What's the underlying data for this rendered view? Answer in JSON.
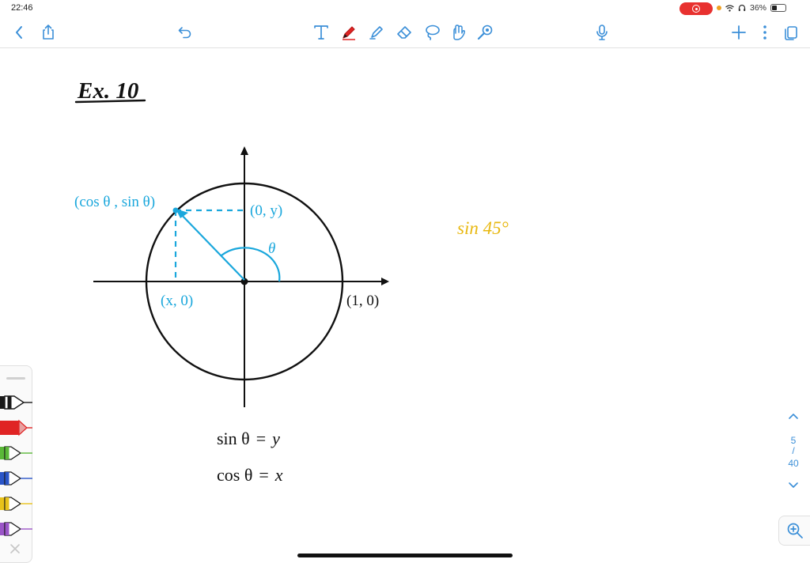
{
  "status_bar": {
    "time": "22:46",
    "battery": "36%",
    "recording_color": "#e8312f"
  },
  "toolbar": {
    "left": [
      "back-icon",
      "share-icon",
      "undo-icon"
    ],
    "tools": [
      "text-tool-icon",
      "pen-tool-icon",
      "highlighter-tool-icon",
      "eraser-tool-icon",
      "lasso-tool-icon",
      "shape-tool-icon",
      "laser-pointer-icon"
    ],
    "right": [
      "microphone-icon",
      "add-page-icon",
      "more-icon",
      "pages-icon"
    ],
    "accent": "#3b8fd8"
  },
  "note": {
    "heading": "Ex. 10",
    "figure": {
      "point_label": "(cos θ , sin θ)",
      "y_proj_label": "(0, y)",
      "x_proj_label": "(x, 0)",
      "unit_point_label": "(1, 0)",
      "angle_label": "θ",
      "diagram_color": "#1aa7dc"
    },
    "equations": [
      {
        "lhs": "sin θ",
        "eq": "=",
        "rhs": "y"
      },
      {
        "lhs": "cos θ",
        "eq": "=",
        "rhs": "x"
      }
    ],
    "side_note": "sin 45°",
    "side_note_color": "#e8b810"
  },
  "pen_tray": {
    "pens": [
      {
        "name": "black",
        "color": "#1a1a1a"
      },
      {
        "name": "red",
        "color": "#e02424"
      },
      {
        "name": "green",
        "color": "#5ab838"
      },
      {
        "name": "blue",
        "color": "#2a55c8"
      },
      {
        "name": "yellow",
        "color": "#e8c21a"
      },
      {
        "name": "purple",
        "color": "#9b55c8"
      }
    ]
  },
  "page_nav": {
    "current": "5",
    "total": "40",
    "separator": "/"
  }
}
